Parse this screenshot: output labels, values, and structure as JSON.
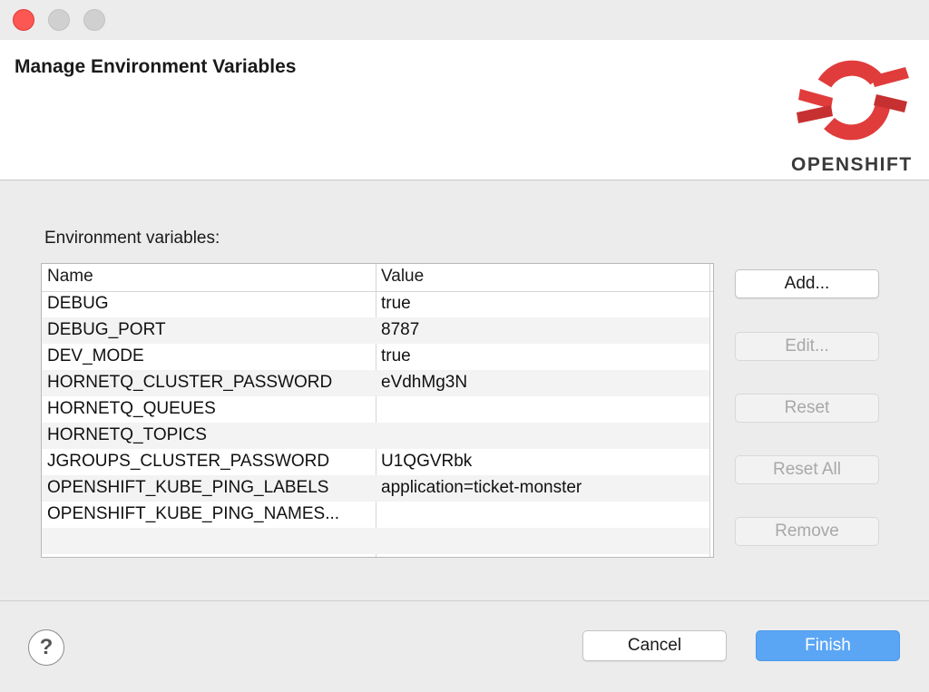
{
  "window": {
    "title_buttons": [
      "close",
      "minimize",
      "maximize"
    ]
  },
  "banner": {
    "title": "Manage Environment Variables",
    "logo_text": "OPENSHIFT",
    "logo_icon": "openshift-logo-icon",
    "logo_color": "#e03c3c"
  },
  "env": {
    "label": "Environment variables:",
    "columns": {
      "name": "Name",
      "value": "Value"
    },
    "rows": [
      {
        "name": "DEBUG",
        "value": "true"
      },
      {
        "name": "DEBUG_PORT",
        "value": "8787"
      },
      {
        "name": "DEV_MODE",
        "value": "true"
      },
      {
        "name": "HORNETQ_CLUSTER_PASSWORD",
        "value": "eVdhMg3N"
      },
      {
        "name": "HORNETQ_QUEUES",
        "value": ""
      },
      {
        "name": "HORNETQ_TOPICS",
        "value": ""
      },
      {
        "name": "JGROUPS_CLUSTER_PASSWORD",
        "value": "U1QGVRbk"
      },
      {
        "name": "OPENSHIFT_KUBE_PING_LABELS",
        "value": "application=ticket-monster"
      },
      {
        "name": "OPENSHIFT_KUBE_PING_NAMES...",
        "value": ""
      },
      {
        "name": "",
        "value": ""
      }
    ]
  },
  "side_buttons": {
    "add": "Add...",
    "edit": "Edit...",
    "reset": "Reset",
    "reset_all": "Reset All",
    "remove": "Remove"
  },
  "footer": {
    "help_glyph": "?",
    "cancel": "Cancel",
    "finish": "Finish"
  },
  "colors": {
    "accent": "#5aa6f5",
    "close_button": "#fc5753"
  }
}
